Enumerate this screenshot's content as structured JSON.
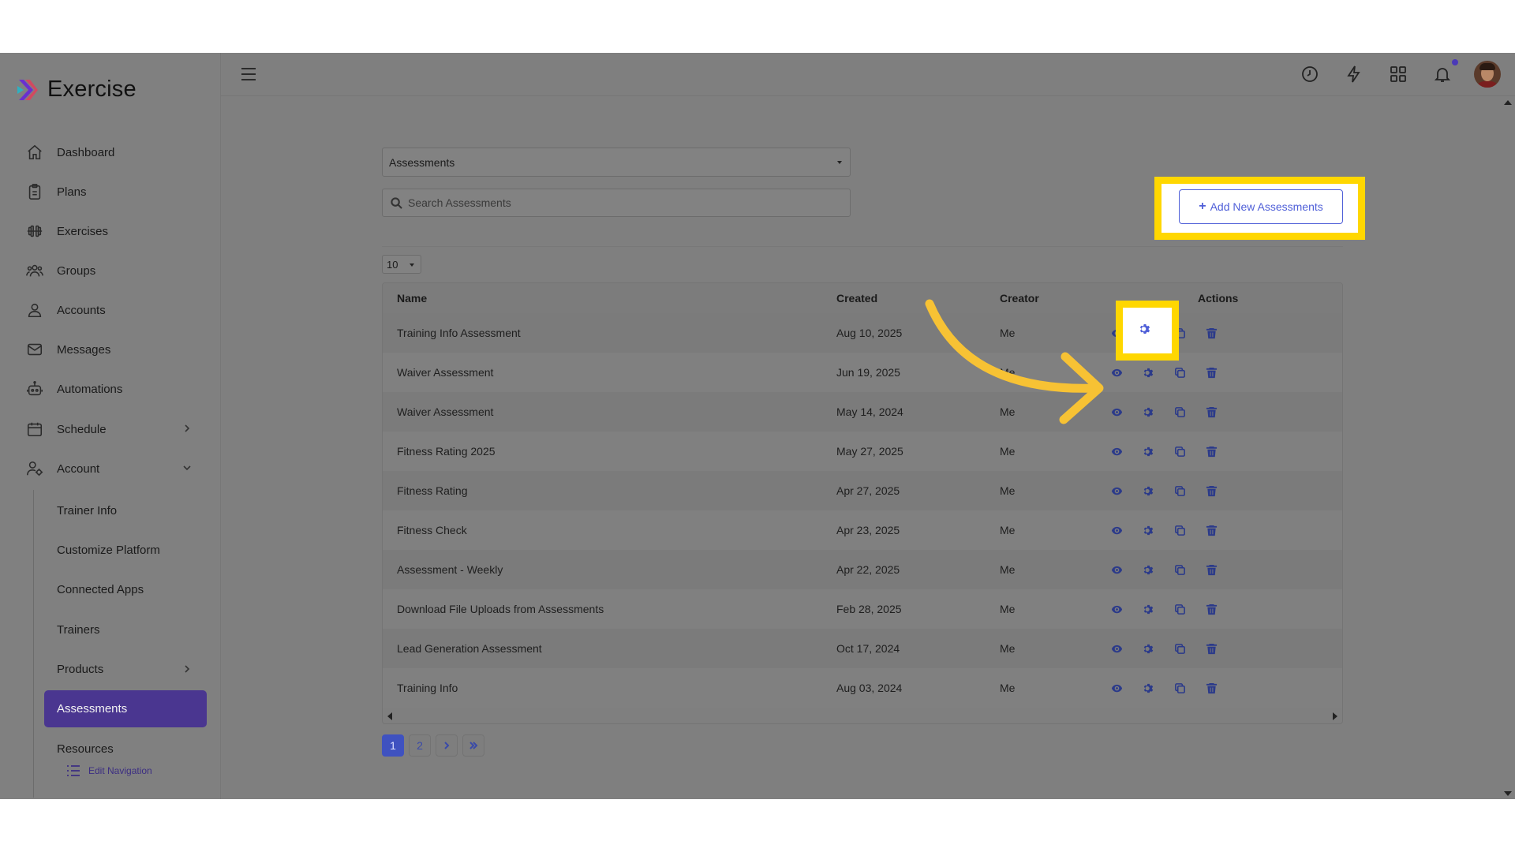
{
  "brand": {
    "name": "Exercise"
  },
  "sidebar": {
    "items": [
      {
        "label": "Dashboard",
        "icon": "home-icon"
      },
      {
        "label": "Plans",
        "icon": "clipboard-icon"
      },
      {
        "label": "Exercises",
        "icon": "dumbbell-icon"
      },
      {
        "label": "Groups",
        "icon": "users-icon"
      },
      {
        "label": "Accounts",
        "icon": "user-icon"
      },
      {
        "label": "Messages",
        "icon": "mail-icon"
      },
      {
        "label": "Automations",
        "icon": "robot-icon"
      },
      {
        "label": "Schedule",
        "icon": "calendar-icon"
      },
      {
        "label": "Account",
        "icon": "user-gear-icon"
      }
    ],
    "sub_items": [
      {
        "label": "Trainer Info"
      },
      {
        "label": "Customize Platform"
      },
      {
        "label": "Connected Apps"
      },
      {
        "label": "Trainers"
      },
      {
        "label": "Products"
      },
      {
        "label": "Assessments"
      },
      {
        "label": "Resources"
      }
    ],
    "active_item": "Assessments",
    "edit_navigation_label": "Edit Navigation"
  },
  "topbar": {
    "icons": [
      "clock-icon",
      "bolt-icon",
      "grid-icon",
      "bell-icon"
    ],
    "notification_dot_color": "#4b3ab8"
  },
  "main": {
    "category_select": "Assessments",
    "search_placeholder": "Search Assessments",
    "add_button_label": "Add New Assessments",
    "page_size": "10",
    "columns": [
      "Name",
      "Created",
      "Creator",
      "",
      "Actions"
    ],
    "rows": [
      {
        "name": "Training Info Assessment",
        "created": "Aug 10, 2025",
        "creator": "Me"
      },
      {
        "name": "Waiver Assessment",
        "created": "Jun 19, 2025",
        "creator": "Me"
      },
      {
        "name": "Waiver Assessment",
        "created": "May 14, 2024",
        "creator": "Me"
      },
      {
        "name": "Fitness Rating 2025",
        "created": "May 27, 2025",
        "creator": "Me"
      },
      {
        "name": "Fitness Rating",
        "created": "Apr 27, 2025",
        "creator": "Me"
      },
      {
        "name": "Fitness Check",
        "created": "Apr 23, 2025",
        "creator": "Me"
      },
      {
        "name": "Assessment - Weekly",
        "created": "Apr 22, 2025",
        "creator": "Me"
      },
      {
        "name": "Download File Uploads from Assessments",
        "created": "Feb 28, 2025",
        "creator": "Me"
      },
      {
        "name": "Lead Generation Assessment",
        "created": "Oct 17, 2024",
        "creator": "Me"
      },
      {
        "name": "Training Info",
        "created": "Aug 03, 2024",
        "creator": "Me"
      }
    ],
    "pagination": {
      "pages": [
        "1",
        "2"
      ],
      "current": "1"
    }
  },
  "colors": {
    "highlight": "#ffd700",
    "accent": "#4f5fd8",
    "active_nav": "#4a3690",
    "arrow": "#f7c234"
  }
}
